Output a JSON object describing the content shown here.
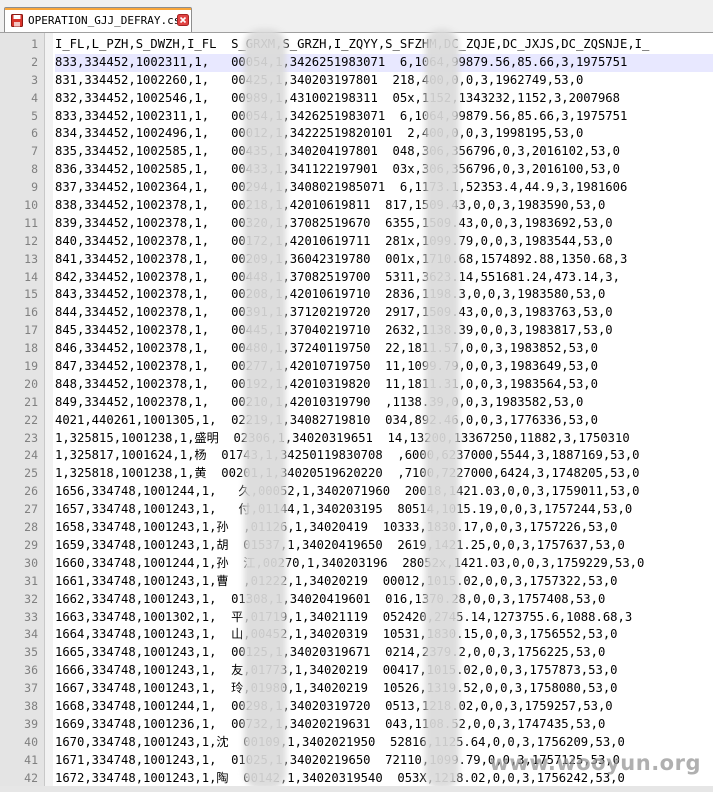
{
  "tab": {
    "filename": "OPERATION_GJJ_DEFRAY.csv",
    "icon": "floppy-disk-red-icon",
    "close_icon": "close-x-icon",
    "accent_color": "#f9a63b"
  },
  "editor": {
    "current_line": 2,
    "current_line_color": "#e8e8ff",
    "lines": [
      {
        "num": "1",
        "text": "I_FL,L_PZH,S_DWZH,I_FL  S_GRXM,S_GRZH,I_ZQYY,S_SFZHM,DC_ZQJE,DC_JXJS,DC_ZQSNJE,I_"
      },
      {
        "num": "2",
        "text": "833,334452,1002311,1,   00054,1,3426251983071  6,1064,99879.56,85.66,3,1975751"
      },
      {
        "num": "3",
        "text": "831,334452,1002260,1,   00425,1,340203197801  218,400,0,0,3,1962749,53,0"
      },
      {
        "num": "4",
        "text": "832,334452,1002546,1,   00989,1,431002198311  05x,1152,1343232,1152,3,2007968"
      },
      {
        "num": "5",
        "text": "833,334452,1002311,1,   00054,1,3426251983071  6,1064,99879.56,85.66,3,1975751"
      },
      {
        "num": "6",
        "text": "834,334452,1002496,1,   00012,1,34222519820101  2,400,0,0,3,1998195,53,0"
      },
      {
        "num": "7",
        "text": "835,334452,1002585,1,   00435,1,340204197801  048,306,356796,0,3,2016102,53,0"
      },
      {
        "num": "8",
        "text": "836,334452,1002585,1,   00433,1,341122197901  03x,306,356796,0,3,2016100,53,0"
      },
      {
        "num": "9",
        "text": "837,334452,1002364,1,   00294,1,3408021985071  6,1173.1,52353.4,44.9,3,1981606"
      },
      {
        "num": "10",
        "text": "838,334452,1002378,1,   00218,1,42010619811  817,1509.43,0,0,3,1983590,53,0"
      },
      {
        "num": "11",
        "text": "839,334452,1002378,1,   00320,1,37082519670  6355,1509.43,0,0,3,1983692,53,0"
      },
      {
        "num": "12",
        "text": "840,334452,1002378,1,   00172,1,42010619711  281x,1099.79,0,0,3,1983544,53,0"
      },
      {
        "num": "13",
        "text": "841,334452,1002378,1,   00209,1,36042319780  001x,1710.68,1574892.88,1350.68,3"
      },
      {
        "num": "14",
        "text": "842,334452,1002378,1,   00448,1,37082519700  5311,3623.14,551681.24,473.14,3,"
      },
      {
        "num": "15",
        "text": "843,334452,1002378,1,   00208,1,42010619710  2836,1198.3,0,0,3,1983580,53,0"
      },
      {
        "num": "16",
        "text": "844,334452,1002378,1,   00391,1,37120219720  2917,1509.43,0,0,3,1983763,53,0"
      },
      {
        "num": "17",
        "text": "845,334452,1002378,1,   00445,1,37040219710  2632,1138.39,0,0,3,1983817,53,0"
      },
      {
        "num": "18",
        "text": "846,334452,1002378,1,   00480,1,37240119750  22,1811.57,0,0,3,1983852,53,0"
      },
      {
        "num": "19",
        "text": "847,334452,1002378,1,   00277,1,42010719750  11,1099.79,0,0,3,1983649,53,0"
      },
      {
        "num": "20",
        "text": "848,334452,1002378,1,   00192,1,42010319820  11,1811.31,0,0,3,1983564,53,0"
      },
      {
        "num": "21",
        "text": "849,334452,1002378,1,   00210,1,42010319790  ,1138.39,0,0,3,1983582,53,0"
      },
      {
        "num": "22",
        "text": "4021,440261,1001305,1,  02219,1,34082719810  034,892.46,0,0,3,1776336,53,0"
      },
      {
        "num": "23",
        "text": "1,325815,1001238,1,盛明  02306,1,34020319651  14,13200,13367250,11882,3,1750310"
      },
      {
        "num": "24",
        "text": "1,325817,1001624,1,杨  01743,1,34250119830708  ,6000,6237000,5544,3,1887169,53,0"
      },
      {
        "num": "25",
        "text": "1,325818,1001238,1,黄  00201,1,34020519620220  ,7100,7227000,6424,3,1748205,53,0"
      },
      {
        "num": "26",
        "text": "1656,334748,1001244,1,   久,00052,1,3402071960  20018,1421.03,0,0,3,1759011,53,0"
      },
      {
        "num": "27",
        "text": "1657,334748,1001243,1,   付,01144,1,340203195  80514,1015.19,0,0,3,1757244,53,0"
      },
      {
        "num": "28",
        "text": "1658,334748,1001243,1,孙  ,01126,1,34020419  10333,1830.17,0,0,3,1757226,53,0"
      },
      {
        "num": "29",
        "text": "1659,334748,1001243,1,胡  01537,1,34020419650  2619,1421.25,0,0,3,1757637,53,0"
      },
      {
        "num": "30",
        "text": "1660,334748,1001244,1,孙  江,00270,1,340203196  28052x,1421.03,0,0,3,1759229,53,0"
      },
      {
        "num": "31",
        "text": "1661,334748,1001243,1,曹  ,01222,1,34020219  00012,1015.02,0,0,3,1757322,53,0"
      },
      {
        "num": "32",
        "text": "1662,334748,1001243,1,  01308,1,34020419601  016,1370.28,0,0,3,1757408,53,0"
      },
      {
        "num": "33",
        "text": "1663,334748,1001302,1,  平,01719,1,34021119  052420,2745.14,1273755.6,1088.68,3"
      },
      {
        "num": "34",
        "text": "1664,334748,1001243,1,  山,00452,1,34020319  10531,1830.15,0,0,3,1756552,53,0"
      },
      {
        "num": "35",
        "text": "1665,334748,1001243,1,  00125,1,34020319671  0214,2379.2,0,0,3,1756225,53,0"
      },
      {
        "num": "36",
        "text": "1666,334748,1001243,1,  友,01773,1,34020219  00417,1015.02,0,0,3,1757873,53,0"
      },
      {
        "num": "37",
        "text": "1667,334748,1001243,1,  玲,01980,1,34020219  10526,1319.52,0,0,3,1758080,53,0"
      },
      {
        "num": "38",
        "text": "1668,334748,1001244,1,  00298,1,34020319720  0513,1218.02,0,0,3,1759257,53,0"
      },
      {
        "num": "39",
        "text": "1669,334748,1001236,1,  00732,1,34020219631  043,1108.52,0,0,3,1747435,53,0"
      },
      {
        "num": "40",
        "text": "1670,334748,1001243,1,沈  00109,1,3402021950  52816,1125.64,0,0,3,1756209,53,0"
      },
      {
        "num": "41",
        "text": "1671,334748,1001243,1,  01025,1,34020219650  72110,1099.79,0,0,3,1757125,53,0"
      },
      {
        "num": "42",
        "text": "1672,334748,1001243,1,陶  00142,1,34020319540  053X,1218.02,0,0,3,1756242,53,0"
      }
    ]
  },
  "watermark": "www.wooyun.org"
}
